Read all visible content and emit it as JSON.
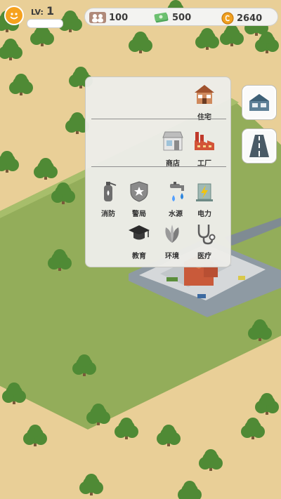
{
  "player": {
    "level_label": "LV:",
    "level": "1"
  },
  "resources": {
    "population": "100",
    "cash": "500",
    "coins": "2640"
  },
  "build_menu": {
    "sections": [
      {
        "items": [
          {
            "label": "住宅",
            "icon": "house-icon"
          }
        ]
      },
      {
        "items": [
          {
            "label": "商店",
            "icon": "shop-icon"
          },
          {
            "label": "工厂",
            "icon": "factory-icon"
          }
        ]
      },
      {
        "items": [
          {
            "label": "消防",
            "icon": "fire-extinguisher-icon"
          },
          {
            "label": "警局",
            "icon": "police-badge-icon"
          },
          {
            "label": "水源",
            "icon": "water-tap-icon"
          },
          {
            "label": "电力",
            "icon": "power-icon"
          },
          {
            "label": "教育",
            "icon": "graduation-cap-icon"
          },
          {
            "label": "环境",
            "icon": "leaf-icon"
          },
          {
            "label": "医疗",
            "icon": "stethoscope-icon"
          }
        ]
      }
    ]
  },
  "side_tabs": [
    {
      "name": "building",
      "icon": "building-icon",
      "selected": true
    },
    {
      "name": "road",
      "icon": "road-icon",
      "selected": false
    }
  ],
  "colors": {
    "sand": "#e9cf97",
    "grass": "#93ad5a",
    "tree": "#4f8a35",
    "coin": "#f0a020"
  }
}
